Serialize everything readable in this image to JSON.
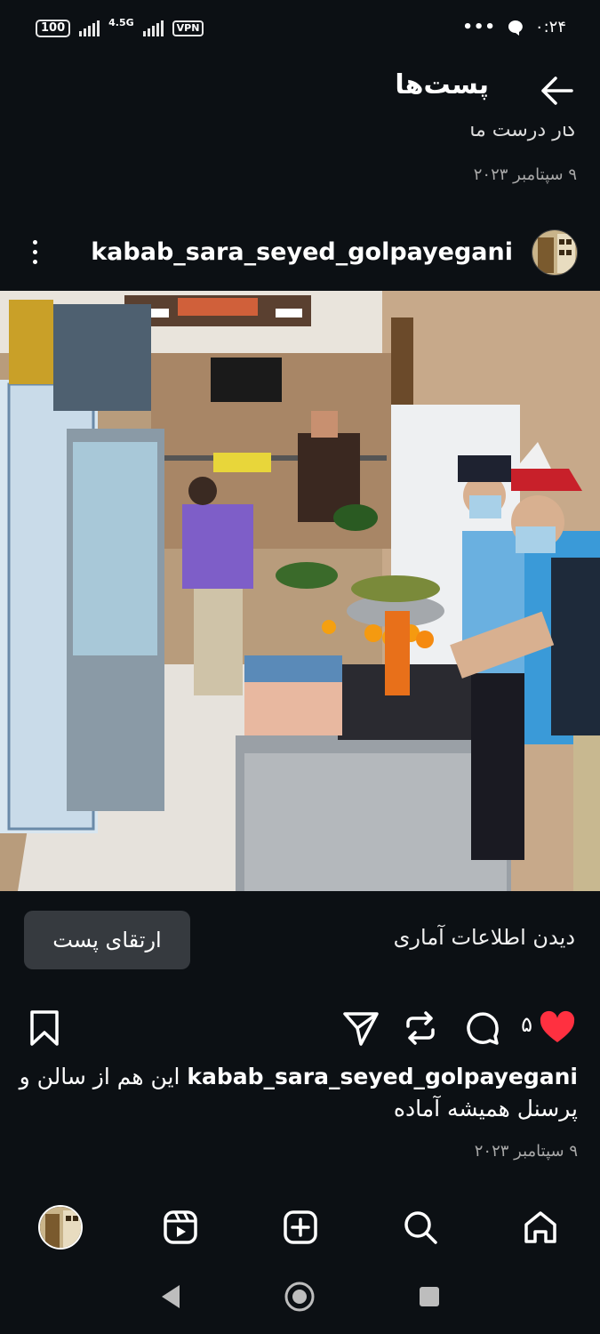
{
  "status_bar": {
    "battery": "100",
    "network": "4.5G",
    "vpn": "VPN",
    "more": "•••",
    "time": "۰:۲۴"
  },
  "header": {
    "title": "پست‌ها"
  },
  "previous_post": {
    "caption_fragment": "کار درست ما",
    "date": "۹ سپتامبر ۲۰۲۳"
  },
  "post": {
    "username": "kabab_sara_seyed_golpayegani",
    "photo_description_icon": "photo",
    "insights_label": "دیدن اطلاعات آماری",
    "boost_label": "ارتقای پست",
    "like_count": "۵",
    "caption_username": "kabab_sara_seyed_golpayegani",
    "caption_text": "این هم از سالن و پرسنل همیشه آماده",
    "date": "۹ سپتامبر ۲۰۲۳"
  },
  "colors": {
    "background": "#0c1014",
    "like_red": "#ff3040",
    "secondary_text": "#a8a8a8",
    "button_bg": "#363a3f"
  },
  "bottom_nav": [
    "profile-icon",
    "reels-icon",
    "create-icon",
    "search-icon",
    "home-icon"
  ],
  "system_nav": [
    "back-triangle-icon",
    "home-circle-icon",
    "recents-square-icon"
  ]
}
